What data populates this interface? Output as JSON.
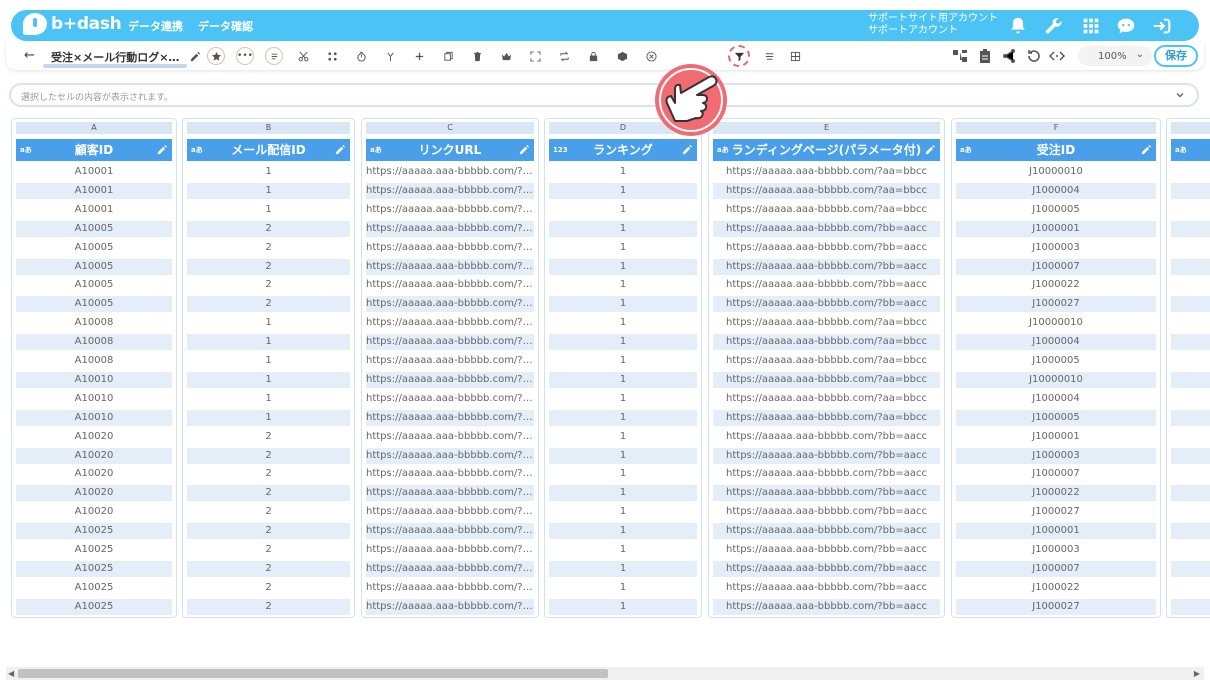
{
  "app": {
    "logo_text": "b+dash",
    "nav": [
      "データ連携",
      "データ確認"
    ],
    "account_line1": "サポートサイト用アカウント",
    "account_line2": "サポートアカウント",
    "brand_color": "#4cc3f5"
  },
  "toolbar": {
    "back": "←",
    "file_title": "受注×メール行動ログ×…",
    "zoom": "100%",
    "save_label": "保存",
    "tools": [
      "edit-icon",
      "star-icon",
      "more-icon",
      "list-icon",
      "scissors-icon",
      "merge-icon",
      "timer-icon",
      "branch-icon",
      "plus-icon",
      "copy-icon",
      "trash-icon",
      "crown-icon",
      "expand-icon",
      "repeat-icon",
      "lock-icon",
      "box-icon",
      "close-circle-icon",
      "filter-icon",
      "sort-icon",
      "grid-icon"
    ]
  },
  "cellbar": {
    "placeholder": "選択したセルの内容が表示されます。"
  },
  "grid": {
    "columns": [
      {
        "letter": "A",
        "type": "aあ",
        "name": "顧客ID",
        "values": [
          "A10001",
          "A10001",
          "A10001",
          "A10005",
          "A10005",
          "A10005",
          "A10005",
          "A10005",
          "A10008",
          "A10008",
          "A10008",
          "A10010",
          "A10010",
          "A10010",
          "A10020",
          "A10020",
          "A10020",
          "A10020",
          "A10020",
          "A10025",
          "A10025",
          "A10025",
          "A10025",
          "A10025"
        ]
      },
      {
        "letter": "B",
        "type": "aあ",
        "name": "メール配信ID",
        "values": [
          "1",
          "1",
          "1",
          "2",
          "2",
          "2",
          "2",
          "2",
          "1",
          "1",
          "1",
          "1",
          "1",
          "1",
          "2",
          "2",
          "2",
          "2",
          "2",
          "2",
          "2",
          "2",
          "2",
          "2"
        ]
      },
      {
        "letter": "C",
        "type": "aあ",
        "name": "リンクURL",
        "values": [
          "https://aaaaa.aaa-bbbbb.com/?aa...",
          "https://aaaaa.aaa-bbbbb.com/?aa...",
          "https://aaaaa.aaa-bbbbb.com/?aa...",
          "https://aaaaa.aaa-bbbbb.com/?bb...",
          "https://aaaaa.aaa-bbbbb.com/?bb...",
          "https://aaaaa.aaa-bbbbb.com/?bb...",
          "https://aaaaa.aaa-bbbbb.com/?bb...",
          "https://aaaaa.aaa-bbbbb.com/?bb...",
          "https://aaaaa.aaa-bbbbb.com/?aa...",
          "https://aaaaa.aaa-bbbbb.com/?aa...",
          "https://aaaaa.aaa-bbbbb.com/?aa...",
          "https://aaaaa.aaa-bbbbb.com/?aa...",
          "https://aaaaa.aaa-bbbbb.com/?aa...",
          "https://aaaaa.aaa-bbbbb.com/?aa...",
          "https://aaaaa.aaa-bbbbb.com/?bb...",
          "https://aaaaa.aaa-bbbbb.com/?bb...",
          "https://aaaaa.aaa-bbbbb.com/?bb...",
          "https://aaaaa.aaa-bbbbb.com/?bb...",
          "https://aaaaa.aaa-bbbbb.com/?bb...",
          "https://aaaaa.aaa-bbbbb.com/?bb...",
          "https://aaaaa.aaa-bbbbb.com/?bb...",
          "https://aaaaa.aaa-bbbbb.com/?bb...",
          "https://aaaaa.aaa-bbbbb.com/?bb...",
          "https://aaaaa.aaa-bbbbb.com/?bb..."
        ]
      },
      {
        "letter": "D",
        "type": "123",
        "name": "ランキング",
        "values": [
          "1",
          "1",
          "1",
          "1",
          "1",
          "1",
          "1",
          "1",
          "1",
          "1",
          "1",
          "1",
          "1",
          "1",
          "1",
          "1",
          "1",
          "1",
          "1",
          "1",
          "1",
          "1",
          "1",
          "1"
        ]
      },
      {
        "letter": "E",
        "type": "aあ",
        "name": "ランディングページ(パラメータ付)",
        "values": [
          "https://aaaaa.aaa-bbbbb.com/?aa=bbcc",
          "https://aaaaa.aaa-bbbbb.com/?aa=bbcc",
          "https://aaaaa.aaa-bbbbb.com/?aa=bbcc",
          "https://aaaaa.aaa-bbbbb.com/?bb=aacc",
          "https://aaaaa.aaa-bbbbb.com/?bb=aacc",
          "https://aaaaa.aaa-bbbbb.com/?bb=aacc",
          "https://aaaaa.aaa-bbbbb.com/?bb=aacc",
          "https://aaaaa.aaa-bbbbb.com/?bb=aacc",
          "https://aaaaa.aaa-bbbbb.com/?aa=bbcc",
          "https://aaaaa.aaa-bbbbb.com/?aa=bbcc",
          "https://aaaaa.aaa-bbbbb.com/?aa=bbcc",
          "https://aaaaa.aaa-bbbbb.com/?aa=bbcc",
          "https://aaaaa.aaa-bbbbb.com/?aa=bbcc",
          "https://aaaaa.aaa-bbbbb.com/?aa=bbcc",
          "https://aaaaa.aaa-bbbbb.com/?bb=aacc",
          "https://aaaaa.aaa-bbbbb.com/?bb=aacc",
          "https://aaaaa.aaa-bbbbb.com/?bb=aacc",
          "https://aaaaa.aaa-bbbbb.com/?bb=aacc",
          "https://aaaaa.aaa-bbbbb.com/?bb=aacc",
          "https://aaaaa.aaa-bbbbb.com/?bb=aacc",
          "https://aaaaa.aaa-bbbbb.com/?bb=aacc",
          "https://aaaaa.aaa-bbbbb.com/?bb=aacc",
          "https://aaaaa.aaa-bbbbb.com/?bb=aacc",
          "https://aaaaa.aaa-bbbbb.com/?bb=aacc"
        ]
      },
      {
        "letter": "F",
        "type": "aあ",
        "name": "受注ID",
        "values": [
          "J10000010",
          "J1000004",
          "J1000005",
          "J1000001",
          "J1000003",
          "J1000007",
          "J1000022",
          "J1000027",
          "J10000010",
          "J1000004",
          "J1000005",
          "J10000010",
          "J1000004",
          "J1000005",
          "J1000001",
          "J1000003",
          "J1000007",
          "J1000022",
          "J1000027",
          "J1000001",
          "J1000003",
          "J1000007",
          "J1000022",
          "J1000027"
        ]
      },
      {
        "letter": "",
        "type": "aあ",
        "name": "",
        "values": [
          "",
          "",
          "",
          "",
          "",
          "",
          "",
          "",
          "",
          "",
          "",
          "",
          "",
          "",
          "",
          "",
          "",
          "",
          "",
          "",
          "",
          "",
          "",
          ""
        ]
      }
    ]
  }
}
